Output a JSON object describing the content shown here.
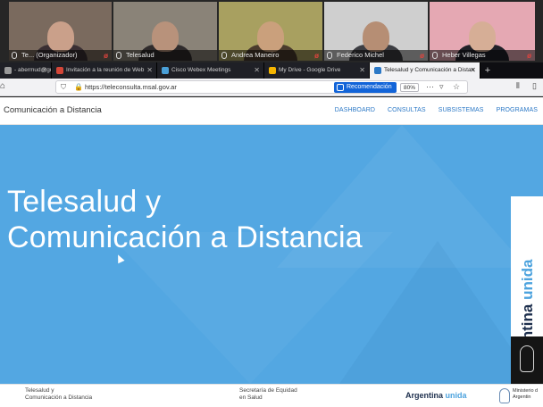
{
  "participants": [
    {
      "name": "Te...",
      "role": "(Organizador)",
      "bg": "#7a6a5e",
      "skin": "#caa08a",
      "shirt": "#3a2f33",
      "mic_muted": true
    },
    {
      "name": "Telesalud",
      "role": "",
      "bg": "#8a8378",
      "skin": "#b8927b",
      "shirt": "#2f2b2c",
      "mic_muted": false
    },
    {
      "name": "Andrea Maneiro",
      "role": "",
      "bg": "#a8a060",
      "skin": "#caa07c",
      "shirt": "#4a3b2d",
      "mic_muted": true
    },
    {
      "name": "Federico Michel",
      "role": "",
      "bg": "#cfcfcf",
      "skin": "#b68e74",
      "shirt": "#3c3d42",
      "mic_muted": true
    },
    {
      "name": "Heber Villegas",
      "role": "",
      "bg": "#e5a8b3",
      "skin": "#d6ae96",
      "shirt": "#202028",
      "mic_muted": true
    }
  ],
  "tabs": [
    {
      "label": "- abermud@gr",
      "active": false,
      "color": "#999999"
    },
    {
      "label": "Invitación a la reunión de Web",
      "active": false,
      "color": "#d44638"
    },
    {
      "label": "Cisco Webex Meetings",
      "active": false,
      "color": "#4aa0d8"
    },
    {
      "label": "My Drive - Google Drive",
      "active": false,
      "color": "#f4b400"
    },
    {
      "label": "Telesalud y Comunicación a Distan",
      "active": true,
      "color": "#2b78c6"
    }
  ],
  "new_tab_label": "+",
  "address": {
    "url": "https://teleconsulta.msal.gov.ar",
    "recommendation_label": "Recomendación",
    "zoom": "80%"
  },
  "site": {
    "title": "Comunicación a Distancia",
    "nav": [
      "DASHBOARD",
      "CONSULTAS",
      "SUBSISTEMAS",
      "PROGRAMAS"
    ]
  },
  "hero": {
    "line1": "Telesalud y",
    "line2": "Comunicación a Distancia",
    "badge_main": "Argentina",
    "badge_accent": "unida"
  },
  "footer": {
    "left_line1": "Telesalud y",
    "left_line2": "Comunicación a Distancia",
    "mid_line1": "Secretaría de Equidad",
    "mid_line2": "en Salud",
    "brand_main": "Argentina",
    "brand_accent": "unida",
    "ministry_line1": "Ministerio d",
    "ministry_line2": "Argentin"
  }
}
